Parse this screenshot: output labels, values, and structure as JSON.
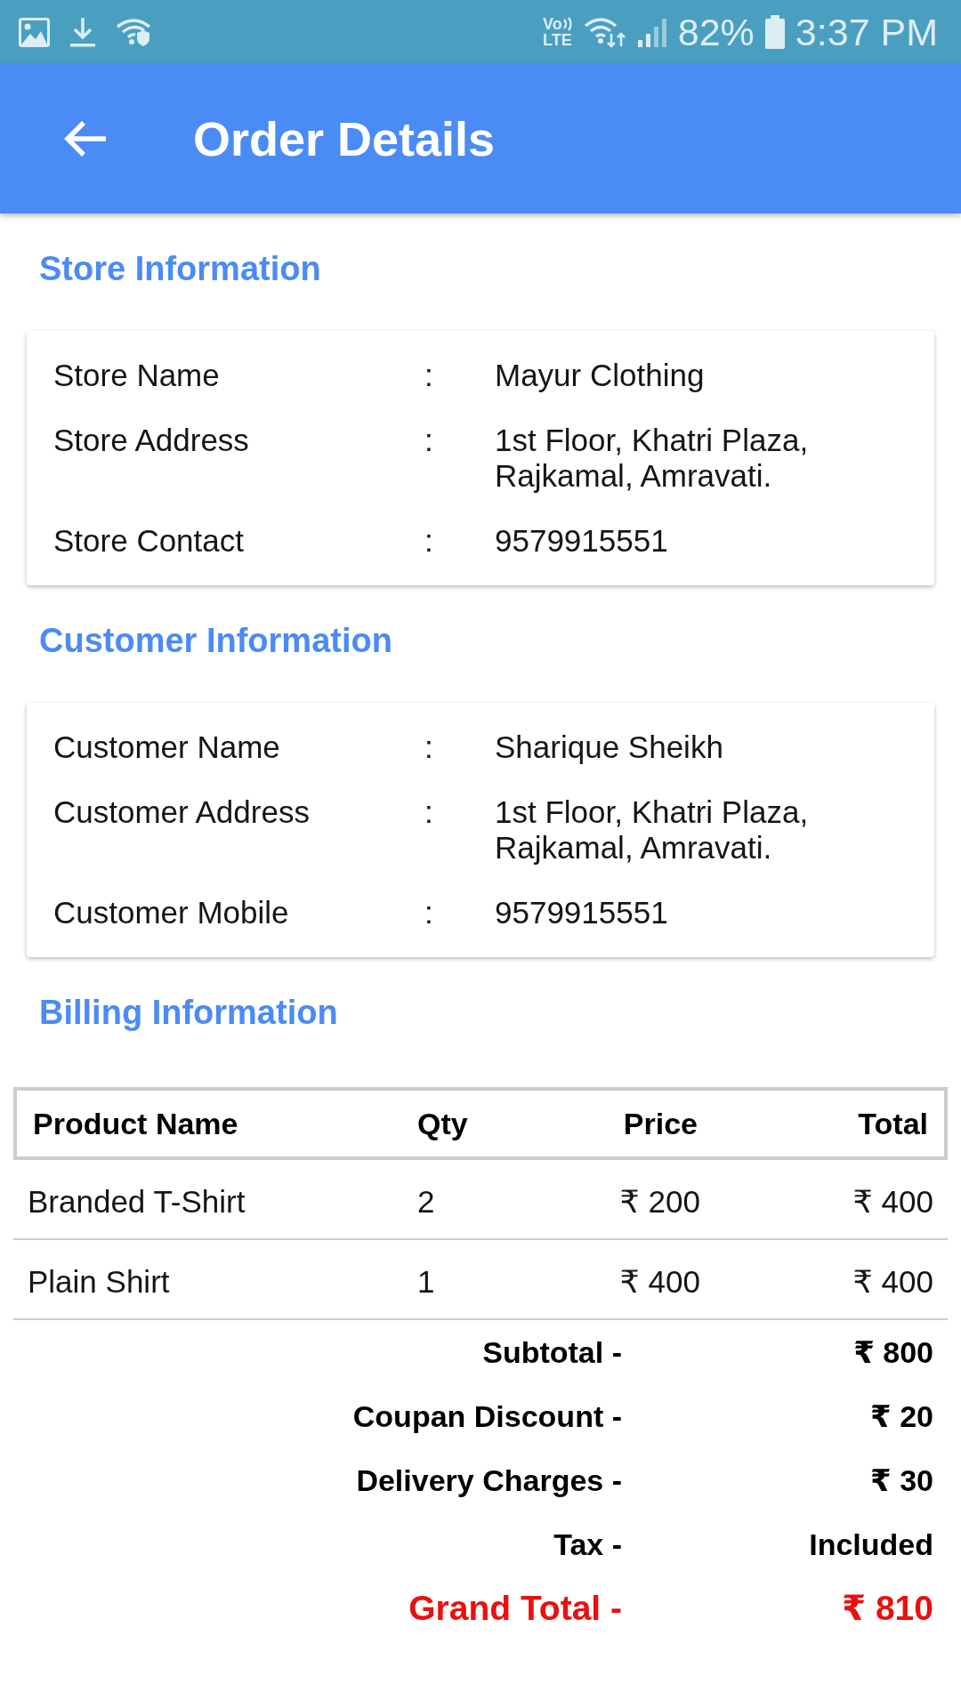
{
  "status_bar": {
    "volte": "Vo",
    "network": "LTE",
    "battery": "82%",
    "time": "3:37 PM"
  },
  "app_bar": {
    "title": "Order Details"
  },
  "sections": [
    {
      "kind": "info",
      "title": "Store Information",
      "rows": [
        {
          "label": "Store Name",
          "separator": ":",
          "value": "Mayur Clothing"
        },
        {
          "label": "Store Address",
          "separator": ":",
          "value": "1st Floor, Khatri Plaza, Rajkamal, Amravati."
        },
        {
          "label": "Store Contact",
          "separator": ":",
          "value": "9579915551"
        }
      ]
    },
    {
      "kind": "info",
      "title": "Customer Information",
      "rows": [
        {
          "label": "Customer Name",
          "separator": ":",
          "value": "Sharique Sheikh"
        },
        {
          "label": "Customer Address",
          "separator": ":",
          "value": "1st Floor, Khatri Plaza, Rajkamal, Amravati."
        },
        {
          "label": "Customer Mobile",
          "separator": ":",
          "value": "9579915551"
        }
      ]
    },
    {
      "kind": "billing",
      "title": "Billing Information",
      "columns": [
        "Product Name",
        "Qty",
        "Price",
        "Total"
      ],
      "rows": [
        {
          "product": "Branded T-Shirt",
          "qty": "2",
          "price": "₹ 200",
          "total": "₹ 400"
        },
        {
          "product": "Plain Shirt",
          "qty": "1",
          "price": "₹ 400",
          "total": "₹ 400"
        }
      ],
      "summary": [
        {
          "kind": "normal",
          "label": "Subtotal -",
          "value": "₹ 800"
        },
        {
          "kind": "normal",
          "label": "Coupan Discount -",
          "value": "₹ 20"
        },
        {
          "kind": "normal",
          "label": "Delivery Charges -",
          "value": "₹ 30"
        },
        {
          "kind": "normal",
          "label": "Tax -",
          "value": "Included"
        },
        {
          "kind": "grand",
          "label": "Grand Total -",
          "value": "₹ 810"
        }
      ]
    }
  ]
}
